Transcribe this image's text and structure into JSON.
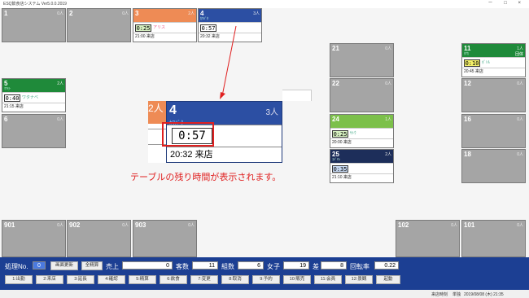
{
  "window": {
    "title": "ESQ飲食店システム  Ver5.0.0.2019",
    "controls": "－ □ ×"
  },
  "tables": [
    {
      "id": "t1",
      "num": "1",
      "cap": "0人"
    },
    {
      "id": "t2",
      "num": "2",
      "cap": "0人"
    },
    {
      "id": "t3",
      "num": "3",
      "cap": "2人",
      "sub": "",
      "timer": "0:25",
      "name": "アリス",
      "time": "21:00 来店"
    },
    {
      "id": "t4",
      "num": "4",
      "cap": "3人",
      "sub": "ｶﾜﾊﾞﾀ",
      "timer": "0:57",
      "name": "",
      "time": "20:32 来店"
    },
    {
      "id": "t5",
      "num": "5",
      "cap": "2人",
      "sub": "ﾏﾂﾓﾄ",
      "timer": "0:40",
      "name": "ワタナベ",
      "time": "21:15 来店"
    },
    {
      "id": "t6",
      "num": "6",
      "cap": "0人"
    },
    {
      "id": "t11",
      "num": "11",
      "cap": "1人",
      "sub": "ﾀﾅｶ",
      "tag": "団体",
      "timer": "0:10",
      "name": "ﾎﾞﾄﾙ",
      "time": "20:45 来店"
    },
    {
      "id": "t12",
      "num": "12",
      "cap": "0人"
    },
    {
      "id": "t16",
      "num": "16",
      "cap": "0人"
    },
    {
      "id": "t18",
      "num": "18",
      "cap": "0人"
    },
    {
      "id": "t21",
      "num": "21",
      "cap": "0人"
    },
    {
      "id": "t22",
      "num": "22",
      "cap": "0人"
    },
    {
      "id": "t24",
      "num": "24",
      "cap": "1人",
      "sub": "",
      "timer": "0:25",
      "name": "ｻﾄｳ",
      "time": "20:00 来店"
    },
    {
      "id": "t25",
      "num": "25",
      "cap": "2人",
      "sub": "ｺﾊﾞﾔｼ",
      "timer": "0:35",
      "name": "",
      "time": "21:10 来店"
    },
    {
      "id": "t901",
      "num": "901",
      "cap": "0人"
    },
    {
      "id": "t902",
      "num": "902",
      "cap": "0人"
    },
    {
      "id": "t903",
      "num": "903",
      "cap": "0人"
    },
    {
      "id": "t102",
      "num": "102",
      "cap": "0人"
    },
    {
      "id": "t101",
      "num": "101",
      "cap": "0人"
    }
  ],
  "zoom": {
    "left_num": "2人",
    "num": "4",
    "cap": "3人",
    "sub": "ｶﾜﾊﾞﾀ",
    "timer": "0:57",
    "time": "20:32 来店"
  },
  "caption": "テーブルの残り時間が表示されます。",
  "panel": {
    "proc_label": "処理No.",
    "proc_value": "0",
    "refresh_btn": "画面更新",
    "total_btn": "全精算",
    "sales_label": "売上",
    "sales_value": "0",
    "guests_label": "客数",
    "guests_value": "11",
    "groups_label": "組数",
    "groups_value": "6",
    "female_label": "女子",
    "female_value": "19",
    "diff_label": "差",
    "diff_value": "8",
    "turnover_label": "回転率",
    "turnover_value": "0.22",
    "fkeys": [
      "1:出勤",
      "2:来店",
      "3:延長",
      "4:確認",
      "5:精算",
      "6:飲食",
      "7:変更",
      "8:取消",
      "9:予約",
      "10:販売",
      "11:会員",
      "12:景観",
      "起動"
    ]
  },
  "status": {
    "label": "来店時刻",
    "mode": "単独",
    "datetime": "2019/08/08 (木) 21:35"
  },
  "colors": {
    "orange": "#ee8b55",
    "blue": "#2c4fa3",
    "green": "#1f8a3a",
    "navy": "#1d2e5a",
    "panel": "#1c3f93",
    "red": "#e02020"
  }
}
